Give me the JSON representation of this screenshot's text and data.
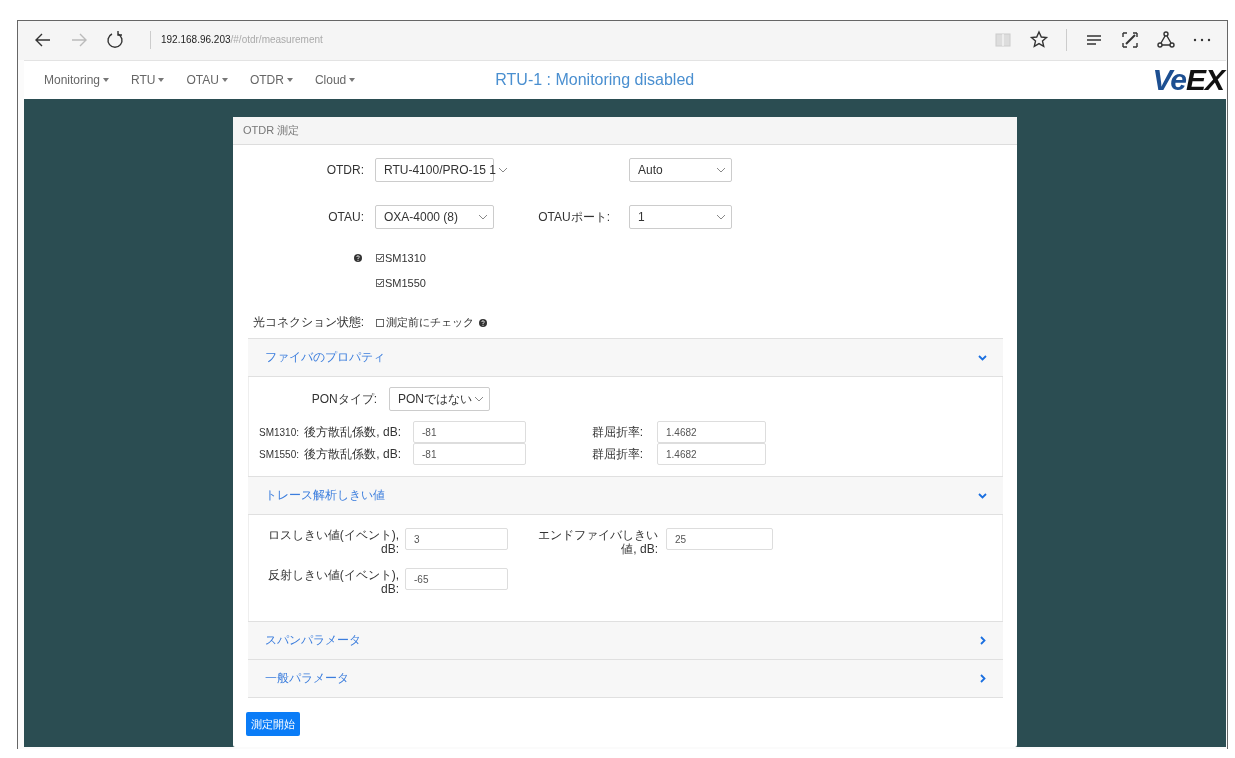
{
  "browser": {
    "url": {
      "host": "192.168.96.203",
      "path": "/#/otdr/measurement"
    },
    "forward_disabled": true
  },
  "navbar": {
    "menus": [
      {
        "label": "Monitoring"
      },
      {
        "label": "RTU"
      },
      {
        "label": "OTAU"
      },
      {
        "label": "OTDR"
      },
      {
        "label": "Cloud"
      }
    ],
    "status": "RTU-1 : Monitoring disabled",
    "logo": "VeEX"
  },
  "card": {
    "title": "OTDR 測定",
    "device_rows": [
      {
        "left": {
          "label": "OTDR:",
          "value": "RTU-4100/PRO-15 1"
        },
        "right": {
          "value": "Auto"
        }
      },
      {
        "left": {
          "label": "OTAU:",
          "value": "OXA-4000 (8)"
        },
        "right": {
          "label": "OTAUポート:",
          "value": "1"
        }
      }
    ],
    "wavelengths": [
      {
        "label": "SM1310",
        "checked": true
      },
      {
        "label": "SM1550",
        "checked": true
      }
    ],
    "connection_check": {
      "label": "光コネクション状態:",
      "option": "測定前にチェック",
      "checked": false
    },
    "sections": [
      {
        "kind": "fiber",
        "title": "ファイバのプロパティ",
        "expanded": true,
        "pon_type": {
          "label": "PONタイプ:",
          "value": "PONではない"
        },
        "rows": [
          {
            "name": "SM1310:",
            "backscatter_label": "後方散乱係数, dB:",
            "backscatter": "-81",
            "index_label": "群屈折率:",
            "index": "1.4682"
          },
          {
            "name": "SM1550:",
            "backscatter_label": "後方散乱係数, dB:",
            "backscatter": "-81",
            "index_label": "群屈折率:",
            "index": "1.4682"
          }
        ]
      },
      {
        "kind": "thresholds",
        "title": "トレース解析しきい値",
        "expanded": true,
        "fields": [
          {
            "label": "ロスしきい値(イベント), dB:",
            "value": "3"
          },
          {
            "label": "エンドファイバしきい値, dB:",
            "value": "25"
          },
          {
            "label": "反射しきい値(イベント), dB:",
            "value": "-65"
          }
        ]
      },
      {
        "title": "スパンパラメータ",
        "expanded": false
      },
      {
        "title": "一般パラメータ",
        "expanded": false
      }
    ],
    "start_button": "測定開始"
  }
}
